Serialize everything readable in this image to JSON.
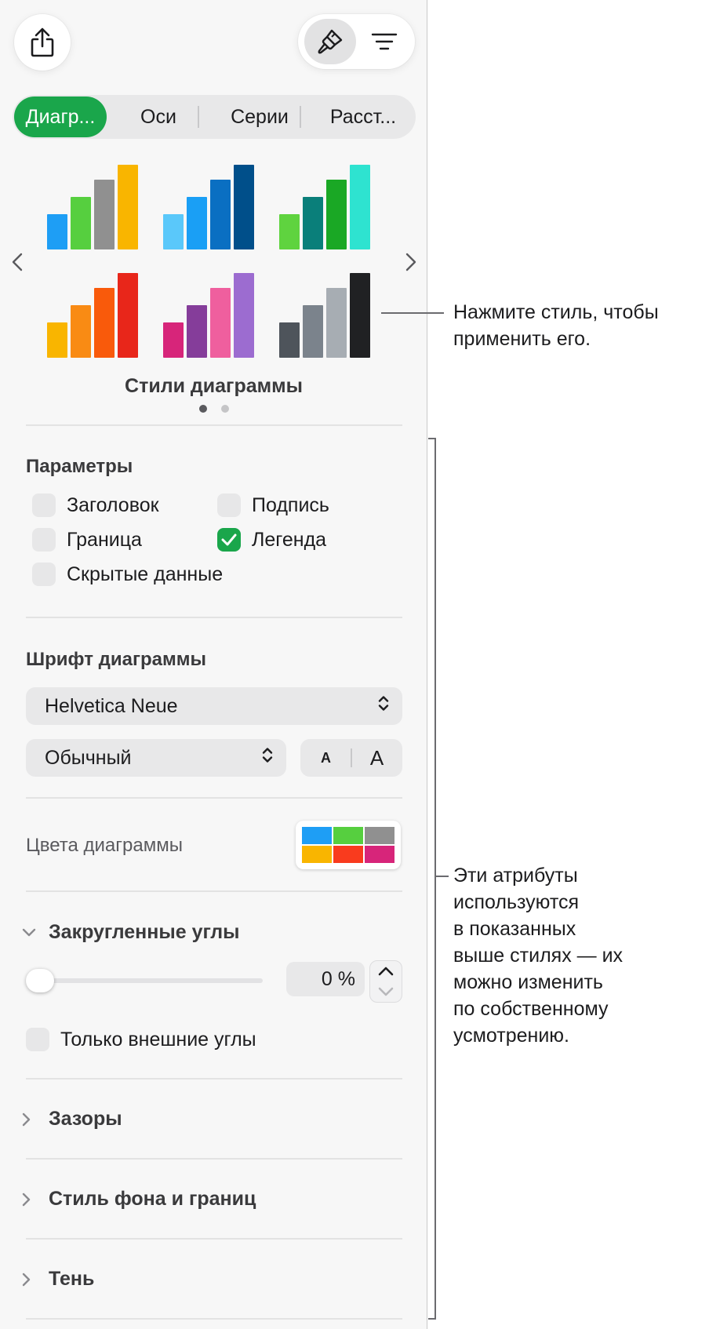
{
  "toolbar": {
    "share_icon": "share-icon",
    "format_icon": "paintbrush-icon",
    "organize_icon": "lines-icon"
  },
  "tabs": [
    {
      "label": "Диагр...",
      "active": true
    },
    {
      "label": "Оси",
      "active": false
    },
    {
      "label": "Серии",
      "active": false
    },
    {
      "label": "Расст...",
      "active": false
    }
  ],
  "styles": {
    "caption": "Стили диаграммы",
    "page_count": 2,
    "current_page": 1,
    "palettes": [
      [
        "#1e9ef5",
        "#56cf3f",
        "#909090",
        "#f9b500"
      ],
      [
        "#5ac8fa",
        "#1a9ff5",
        "#0a6fc2",
        "#004f8a"
      ],
      [
        "#5fd33f",
        "#0a7f7a",
        "#1aa825",
        "#2ee3d0"
      ],
      [
        "#f9b500",
        "#f98b14",
        "#f95a0b",
        "#e8261a"
      ],
      [
        "#d7257a",
        "#853d9a",
        "#ef5f9e",
        "#9c6cd0"
      ],
      [
        "#4e545b",
        "#7b838c",
        "#a7adb3",
        "#202123"
      ]
    ],
    "bar_levels": [
      0.42,
      0.62,
      0.82,
      1.0
    ]
  },
  "parameters": {
    "title": "Параметры",
    "options": [
      {
        "label": "Заголовок",
        "checked": false
      },
      {
        "label": "Подпись",
        "checked": false
      },
      {
        "label": "Граница",
        "checked": false
      },
      {
        "label": "Легенда",
        "checked": true
      },
      {
        "label": "Скрытые данные",
        "checked": false
      }
    ]
  },
  "font": {
    "title": "Шрифт диаграммы",
    "family": "Helvetica Neue",
    "style": "Обычный",
    "size_small": "A",
    "size_large": "A"
  },
  "colors": {
    "label": "Цвета диаграммы",
    "swatches": [
      "#1e9ef5",
      "#56cf3f",
      "#909090",
      "#f9b500",
      "#f93b1e",
      "#d7257a"
    ]
  },
  "rounded": {
    "title": "Закругленные углы",
    "value": "0 %",
    "slider_fraction": 0,
    "outer_only_label": "Только внешние углы"
  },
  "sections": [
    "Зазоры",
    "Стиль фона и границ",
    "Тень"
  ],
  "callouts": {
    "style": "Нажмите стиль, чтобы\nприменить его.",
    "attrs": "Эти атрибуты\nиспользуются\nв показанных\nвыше стилях — их\nможно изменить\nпо собственному\nусмотрению."
  }
}
